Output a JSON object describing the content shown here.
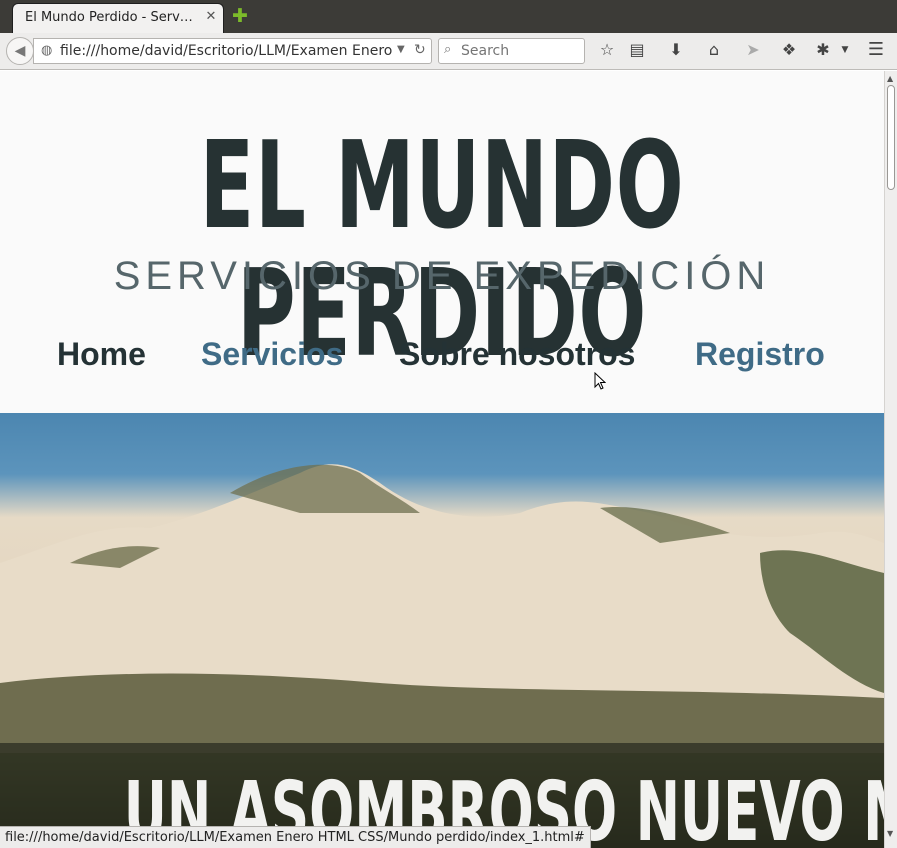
{
  "browser": {
    "tab_title": "El Mundo Perdido - Serv…",
    "url": "file:///home/david/Escritorio/LLM/Examen Enero",
    "search_placeholder": "Search",
    "status_url": "file:///home/david/Escritorio/LLM/Examen Enero HTML CSS/Mundo perdido/index_1.html#"
  },
  "site": {
    "title": "EL MUNDO PERDIDO",
    "subtitle": "SERVICIOS DE EXPEDICIÓN",
    "nav": [
      {
        "label": "Home",
        "color": "#243235"
      },
      {
        "label": "Servicios",
        "color": "#3f6b86"
      },
      {
        "label": "Sobre nosotros",
        "color": "#243235"
      },
      {
        "label": "Registro",
        "color": "#3f6b86"
      }
    ],
    "hero_heading": "UN ASOMBROSO NUEVO MUNDO"
  },
  "icons": {
    "back": "back-arrow-icon",
    "globe": "globe-icon",
    "search": "search-icon",
    "bookmark": "star-icon",
    "reading_list": "clipboard-icon",
    "downloads": "download-icon",
    "home": "home-icon",
    "send": "paper-plane-icon",
    "share": "share-icon",
    "bug": "bug-icon",
    "menu": "hamburger-menu-icon"
  }
}
